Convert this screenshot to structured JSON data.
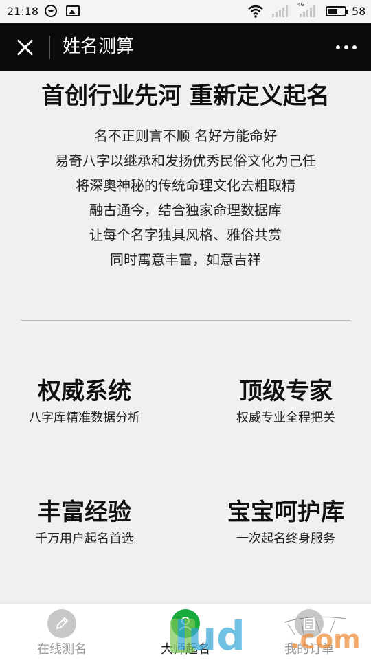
{
  "status_bar": {
    "time": "21:18",
    "network": "4G",
    "battery_level": "58",
    "battery_fraction": 0.58
  },
  "header": {
    "title": "姓名测算",
    "close_icon": "close-icon",
    "more_icon": "more-dots-icon"
  },
  "main": {
    "headline": "首创行业先河 重新定义起名",
    "intro_lines": [
      "名不正则言不顺 名好方能命好",
      "易奇八字以继承和发扬优秀民俗文化为己任",
      "将深奥神秘的传统命理文化去粗取精",
      "融古通今，结合独家命理数据库",
      "让每个名字独具风格、雅俗共赏",
      "同时寓意丰富，如意吉祥"
    ],
    "features": [
      {
        "title": "权威系统",
        "subtitle": "八字库精准数据分析"
      },
      {
        "title": "顶级专家",
        "subtitle": "权威专业全程把关"
      },
      {
        "title": "丰富经验",
        "subtitle": "千万用户起名首选"
      },
      {
        "title": "宝宝呵护库",
        "subtitle": "一次起名终身服务"
      }
    ]
  },
  "bottom_nav": {
    "items": [
      {
        "label": "在线测名",
        "icon": "pencil-icon"
      },
      {
        "label": "大师起名",
        "icon": "person-icon",
        "active": true
      },
      {
        "label": "我的订单",
        "icon": "document-icon"
      }
    ]
  },
  "colors": {
    "background": "#f0f0ee",
    "header": "#0b0b0b",
    "active_nav": "#1aab3f",
    "inactive_nav": "#c7c7c7"
  }
}
